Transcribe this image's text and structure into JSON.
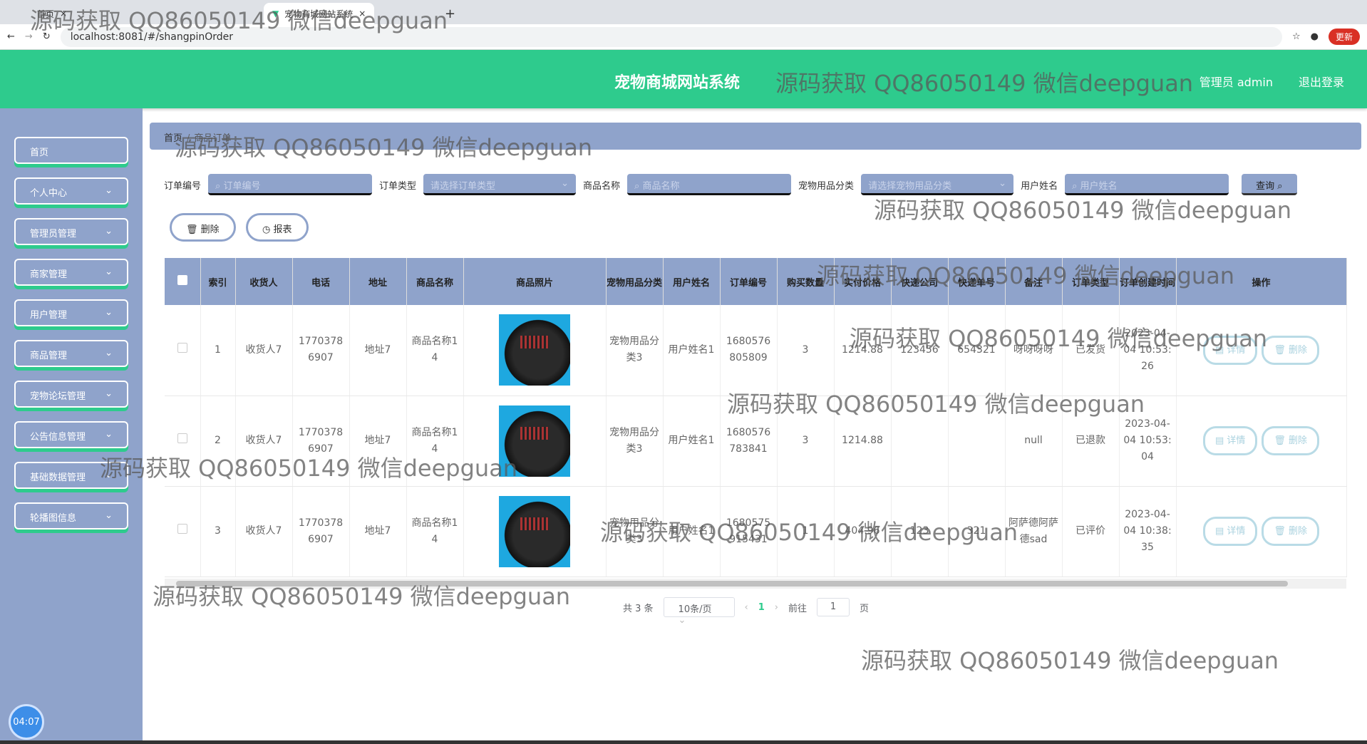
{
  "browser": {
    "tabs": [
      {
        "label": "首页"
      },
      {
        "label": "宠物商城网站系统"
      }
    ],
    "url": "localhost:8081/#/shangpinOrder",
    "update": "更新"
  },
  "header": {
    "title": "宠物商城网站系统",
    "admin": "管理员 admin",
    "logout": "退出登录"
  },
  "sidebar": {
    "items": [
      {
        "label": "首页"
      },
      {
        "label": "个人中心"
      },
      {
        "label": "管理员管理"
      },
      {
        "label": "商家管理"
      },
      {
        "label": "用户管理"
      },
      {
        "label": "商品管理"
      },
      {
        "label": "宠物论坛管理"
      },
      {
        "label": "公告信息管理"
      },
      {
        "label": "基础数据管理"
      },
      {
        "label": "轮播图信息"
      }
    ],
    "clock": "04:07"
  },
  "breadcrumb": {
    "home": "首页",
    "sep": "/",
    "current": "商品订单"
  },
  "search": {
    "order_no_label": "订单编号",
    "order_no_ph": "订单编号",
    "order_type_label": "订单类型",
    "order_type_ph": "请选择订单类型",
    "goods_label": "商品名称",
    "goods_ph": "商品名称",
    "cat_label": "宠物用品分类",
    "cat_ph": "请选择宠物用品分类",
    "user_label": "用户姓名",
    "user_ph": "用户姓名",
    "query": "查询"
  },
  "actions": {
    "delete": "删除",
    "report": "报表"
  },
  "table": {
    "headers": [
      "索引",
      "收货人",
      "电话",
      "地址",
      "商品名称",
      "商品照片",
      "宠物用品分类",
      "用户姓名",
      "订单编号",
      "购买数量",
      "实付价格",
      "快递公司",
      "快递单号",
      "备注",
      "订单类型",
      "订单创建时间",
      "操作"
    ],
    "rows": [
      [
        "1",
        "收货人7",
        "17703786907",
        "地址7",
        "商品名称14",
        "",
        "宠物用品分类3",
        "用户姓名1",
        "1680576805809",
        "3",
        "1214.88",
        "123456",
        "654321",
        "呀呀呀呀",
        "已发货",
        "2023-04-04 10:53:26"
      ],
      [
        "2",
        "收货人7",
        "17703786907",
        "地址7",
        "商品名称14",
        "",
        "宠物用品分类3",
        "用户姓名1",
        "1680576783841",
        "3",
        "1214.88",
        "",
        "",
        "null",
        "已退款",
        "2023-04-04 10:53:04"
      ],
      [
        "3",
        "收货人7",
        "17703786907",
        "地址7",
        "商品名称14",
        "",
        "宠物用品分类3",
        "用户姓名1",
        "1680575915431",
        "1",
        "404.96",
        "123",
        "321",
        "阿萨德阿萨德sad",
        "已评价",
        "2023-04-04 10:38:35"
      ]
    ],
    "detail": "详情",
    "delete": "删除"
  },
  "pagination": {
    "total": "共 3 条",
    "size": "10条/页",
    "current": "1",
    "goto": "前往",
    "goto_value": "1",
    "page": "页"
  },
  "watermark": "源码获取 QQ86050149 微信deepguan"
}
